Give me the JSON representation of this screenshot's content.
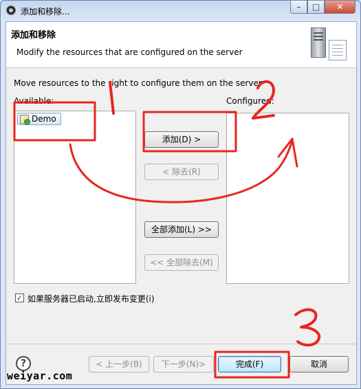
{
  "window": {
    "title": "添加和移除...",
    "controls": {
      "minimize": "–",
      "maximize": "□",
      "close": "✕"
    }
  },
  "header": {
    "title": "添加和移除",
    "subtitle": "Modify the resources that are configured on the server",
    "icon": "server-doc-icon"
  },
  "instructions": "Move resources to the right to configure them on the server",
  "available": {
    "label": "Available:",
    "items": [
      {
        "label": "Demo",
        "icon": "web-project-icon"
      }
    ]
  },
  "configured": {
    "label": "Configured:",
    "items": []
  },
  "buttons": {
    "add": "添加(D) >",
    "remove": "< 除去(R)",
    "add_all": "全部添加(L) >>",
    "remove_all": "<< 全部除去(M)",
    "back": "< 上一步(B)",
    "next": "下一步(N)>",
    "finish": "完成(F)",
    "cancel": "取消"
  },
  "publish_checkbox": {
    "label": "如果服务器已启动,立即发布变更(i)",
    "checked": true
  },
  "help_label": "?",
  "watermark": "weiyar.com",
  "annotations": {
    "color": "#e8261f",
    "numbers": [
      "1",
      "2",
      "3"
    ]
  }
}
